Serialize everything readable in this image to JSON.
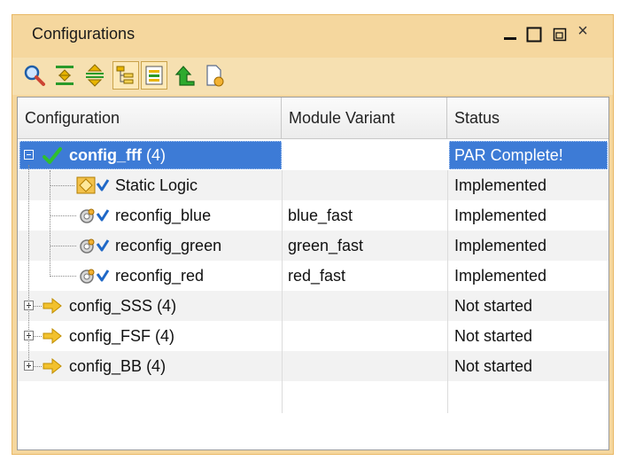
{
  "window": {
    "title": "Configurations",
    "controls": {
      "minimize": "minimize",
      "maximize": "maximize",
      "restore": "restore",
      "close": "×"
    }
  },
  "toolbar": {
    "buttons": [
      {
        "icon": "search-icon",
        "toggled": false
      },
      {
        "icon": "collapse-all-icon",
        "toggled": false
      },
      {
        "icon": "expand-all-icon",
        "toggled": false
      },
      {
        "icon": "hierarchy-view-icon",
        "toggled": true
      },
      {
        "icon": "flat-view-icon",
        "toggled": true
      },
      {
        "icon": "move-up-icon",
        "toggled": false
      },
      {
        "icon": "new-config-icon",
        "toggled": false
      }
    ]
  },
  "columns": [
    "Configuration",
    "Module Variant",
    "Status"
  ],
  "rows": [
    {
      "name": "config_fff",
      "count": " (4)",
      "variant": "",
      "status": "PAR Complete!",
      "expander": "minus",
      "icon": "check-icon"
    },
    {
      "name": "Static Logic",
      "count": "",
      "variant": "",
      "status": "Implemented",
      "icon": "static-logic-icon"
    },
    {
      "name": "reconfig_blue",
      "count": "",
      "variant": "blue_fast",
      "status": "Implemented",
      "icon": "reconfig-module-icon"
    },
    {
      "name": "reconfig_green",
      "count": "",
      "variant": "green_fast",
      "status": "Implemented",
      "icon": "reconfig-module-icon"
    },
    {
      "name": "reconfig_red",
      "count": "",
      "variant": "red_fast",
      "status": "Implemented",
      "icon": "reconfig-module-icon"
    },
    {
      "name": "config_SSS",
      "count": " (4)",
      "variant": "",
      "status": "Not started",
      "expander": "plus",
      "icon": "arrow-right-icon"
    },
    {
      "name": "config_FSF",
      "count": " (4)",
      "variant": "",
      "status": "Not started",
      "expander": "plus",
      "icon": "arrow-right-icon"
    },
    {
      "name": "config_BB",
      "count": " (4)",
      "variant": "",
      "status": "Not started",
      "expander": "plus",
      "icon": "arrow-right-icon"
    }
  ],
  "colors": {
    "selection": "#3d7bd6",
    "window_frame": "#f5d79e",
    "check": "#2fbf2f",
    "arrow": "#f2c12e"
  }
}
